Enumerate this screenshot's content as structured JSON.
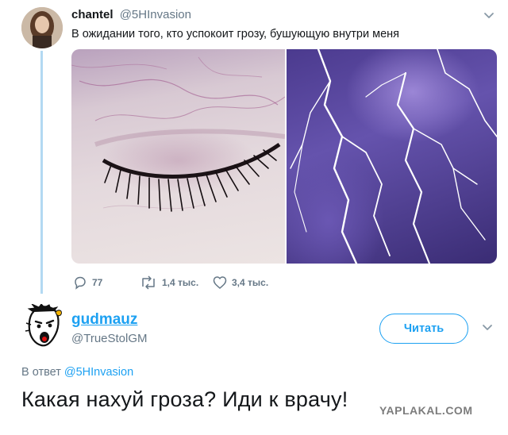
{
  "tweet": {
    "author_name": "chantel",
    "author_handle": "@5HInvasion",
    "text": "В ожидании того, кто успокоит грозу, бушующую внутри меня",
    "actions": {
      "replies": "77",
      "retweets": "1,4 тыс.",
      "likes": "3,4 тыс."
    },
    "media": [
      "closed-eye-photo",
      "lightning-photo"
    ]
  },
  "reply": {
    "author_name": "gudmauz",
    "author_handle": "@TrueStolGM",
    "follow_label": "Читать",
    "in_reply_prefix": "В ответ",
    "in_reply_handle": "@5HInvasion",
    "text": "Какая нахуй гроза? Иди к врачу!"
  },
  "watermark": "YAPLAKAL.COM",
  "colors": {
    "accent": "#1da1f2",
    "secondary_text": "#657786",
    "thread_line": "#b3d9f2"
  },
  "icons": [
    "chevron-down-icon",
    "reply-icon",
    "retweet-icon",
    "like-icon"
  ]
}
